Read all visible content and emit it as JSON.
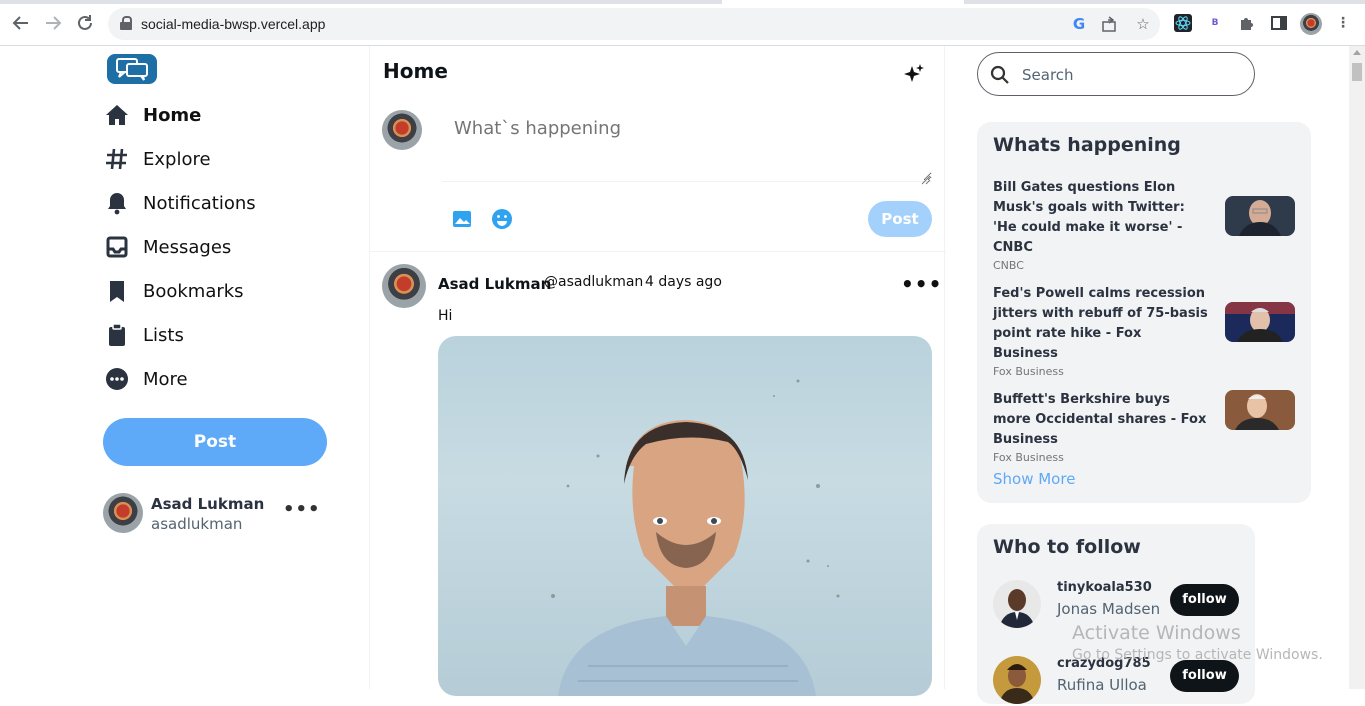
{
  "browser": {
    "url": "social-media-bwsp.vercel.app"
  },
  "sidebar": {
    "items": [
      {
        "label": "Home",
        "icon": "home-icon",
        "active": true
      },
      {
        "label": "Explore",
        "icon": "hashtag-icon"
      },
      {
        "label": "Notifications",
        "icon": "bell-icon"
      },
      {
        "label": "Messages",
        "icon": "inbox-icon"
      },
      {
        "label": "Bookmarks",
        "icon": "bookmark-icon"
      },
      {
        "label": "Lists",
        "icon": "clipboard-icon"
      },
      {
        "label": "More",
        "icon": "more-circle-icon"
      }
    ],
    "post_label": "Post",
    "profile": {
      "name": "Asad Lukman",
      "handle": "asadlukman"
    }
  },
  "main": {
    "title": "Home",
    "composer": {
      "placeholder": "What`s happening",
      "post_label": "Post"
    },
    "posts": [
      {
        "name": "Asad Lukman",
        "handle": "@asadlukman",
        "time": "4 days ago",
        "text": "Hi"
      }
    ]
  },
  "right": {
    "search": {
      "placeholder": "Search"
    },
    "trends": {
      "title": "Whats happening",
      "items": [
        {
          "headline": "Bill Gates questions Elon Musk's goals with Twitter: 'He could make it worse' - CNBC",
          "source": "CNBC"
        },
        {
          "headline": "Fed's Powell calms recession jitters with rebuff of 75-basis point rate hike - Fox Business",
          "source": "Fox Business"
        },
        {
          "headline": "Buffett's Berkshire buys more Occidental shares - Fox Business",
          "source": "Fox Business"
        }
      ],
      "show_more": "Show More"
    },
    "who_to_follow": {
      "title": "Who to follow",
      "items": [
        {
          "username": "tinykoala530",
          "name": "Jonas Madsen",
          "button": "follow"
        },
        {
          "username": "crazydog785",
          "name": "Rufina Ulloa",
          "button": "follow"
        }
      ]
    }
  },
  "watermark": {
    "line1": "Activate Windows",
    "line2": "Go to Settings to activate Windows."
  },
  "colors": {
    "accent": "#5ea9f8",
    "accent_light": "#a4d1fb",
    "card_bg": "#f2f3f5",
    "text_dark": "#2b3340"
  }
}
